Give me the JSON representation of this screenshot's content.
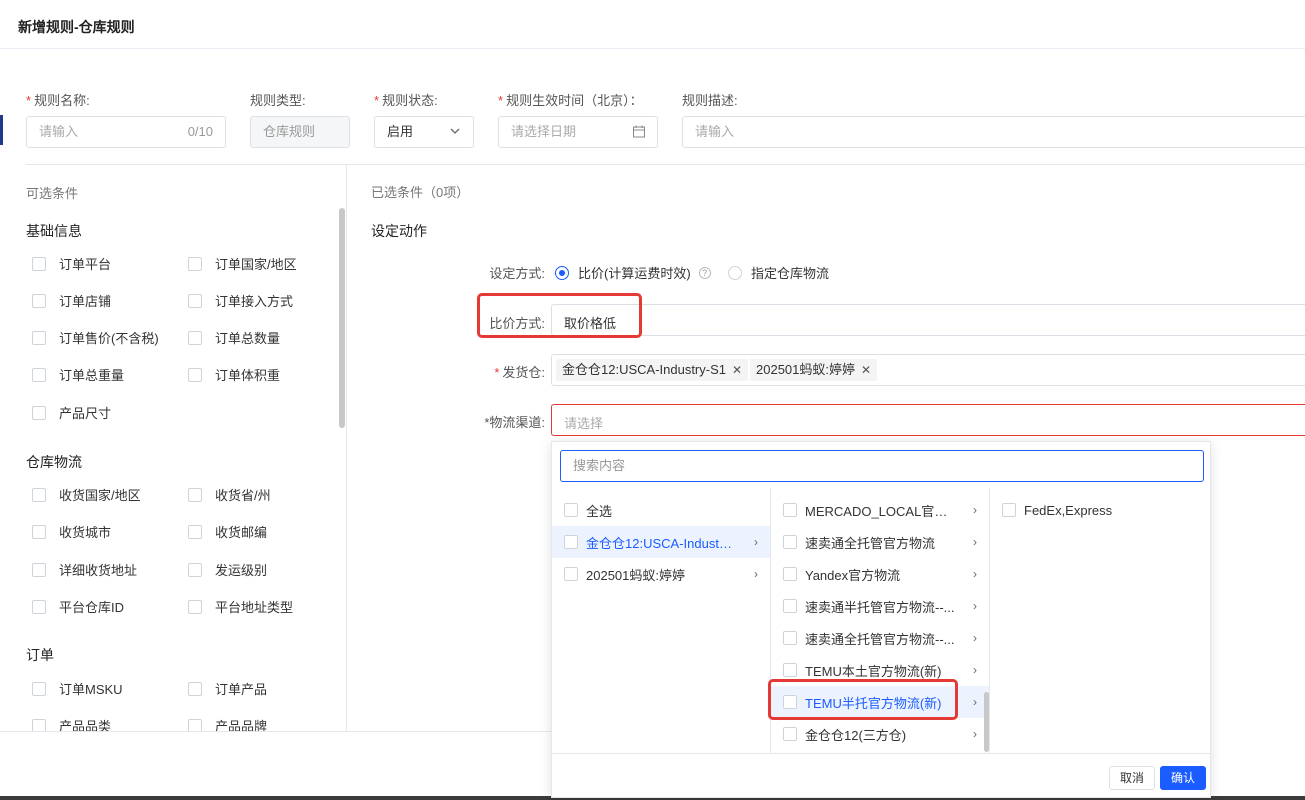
{
  "header": {
    "title": "新增规则-仓库规则"
  },
  "form": {
    "rule_name": {
      "label": "规则名称:",
      "placeholder": "请输入",
      "counter": "0/10"
    },
    "rule_type": {
      "label": "规则类型:",
      "value": "仓库规则"
    },
    "rule_status": {
      "label": "规则状态:",
      "value": "启用"
    },
    "effective_time": {
      "label": "规则生效时间（北京）：",
      "placeholder": "请选择日期"
    },
    "description": {
      "label": "规则描述:",
      "placeholder": "请输入"
    },
    "required_mark": "*"
  },
  "left": {
    "title": "可选条件",
    "groups": [
      {
        "title": "基础信息",
        "items": [
          "订单平台",
          "订单国家/地区",
          "订单店铺",
          "订单接入方式",
          "订单售价(不含税)",
          "订单总数量",
          "订单总重量",
          "订单体积重",
          "产品尺寸"
        ]
      },
      {
        "title": "仓库物流",
        "items": [
          "收货国家/地区",
          "收货省/州",
          "收货城市",
          "收货邮编",
          "详细收货地址",
          "发运级别",
          "平台仓库ID",
          "平台地址类型"
        ]
      },
      {
        "title": "订单",
        "items": [
          "订单MSKU",
          "订单产品",
          "产品品类",
          "产品品牌"
        ]
      }
    ]
  },
  "right": {
    "selected_title": "已选条件（0项）",
    "action_title": "设定动作",
    "mode_label": "设定方式:",
    "mode_options": [
      "比价(计算运费时效)",
      "指定仓库物流"
    ],
    "help_glyph": "?",
    "compare_label": "比价方式:",
    "compare_value": "取价格低",
    "warehouse_label": "发货仓:",
    "warehouse_tags": [
      "金仓仓12:USCA-Industry-S1",
      "202501蚂蚁:婷婷"
    ],
    "channel_label": "*物流渠道:",
    "channel_placeholder": "请选择"
  },
  "dropdown": {
    "search_placeholder": "搜索内容",
    "col1": [
      "全选",
      "金仓仓12:USCA-Industry-...",
      "202501蚂蚁:婷婷"
    ],
    "col2": [
      "MERCADO_LOCAL官方...",
      "速卖通全托管官方物流",
      "Yandex官方物流",
      "速卖通半托管官方物流--...",
      "速卖通全托管官方物流--...",
      "TEMU本土官方物流(新)",
      "TEMU半托官方物流(新)",
      "金仓仓12(三方仓)"
    ],
    "col3": [
      "FedEx,Express"
    ],
    "cancel": "取消",
    "confirm": "确认"
  },
  "colors": {
    "primary": "#1a5cff",
    "error": "#e53935"
  }
}
